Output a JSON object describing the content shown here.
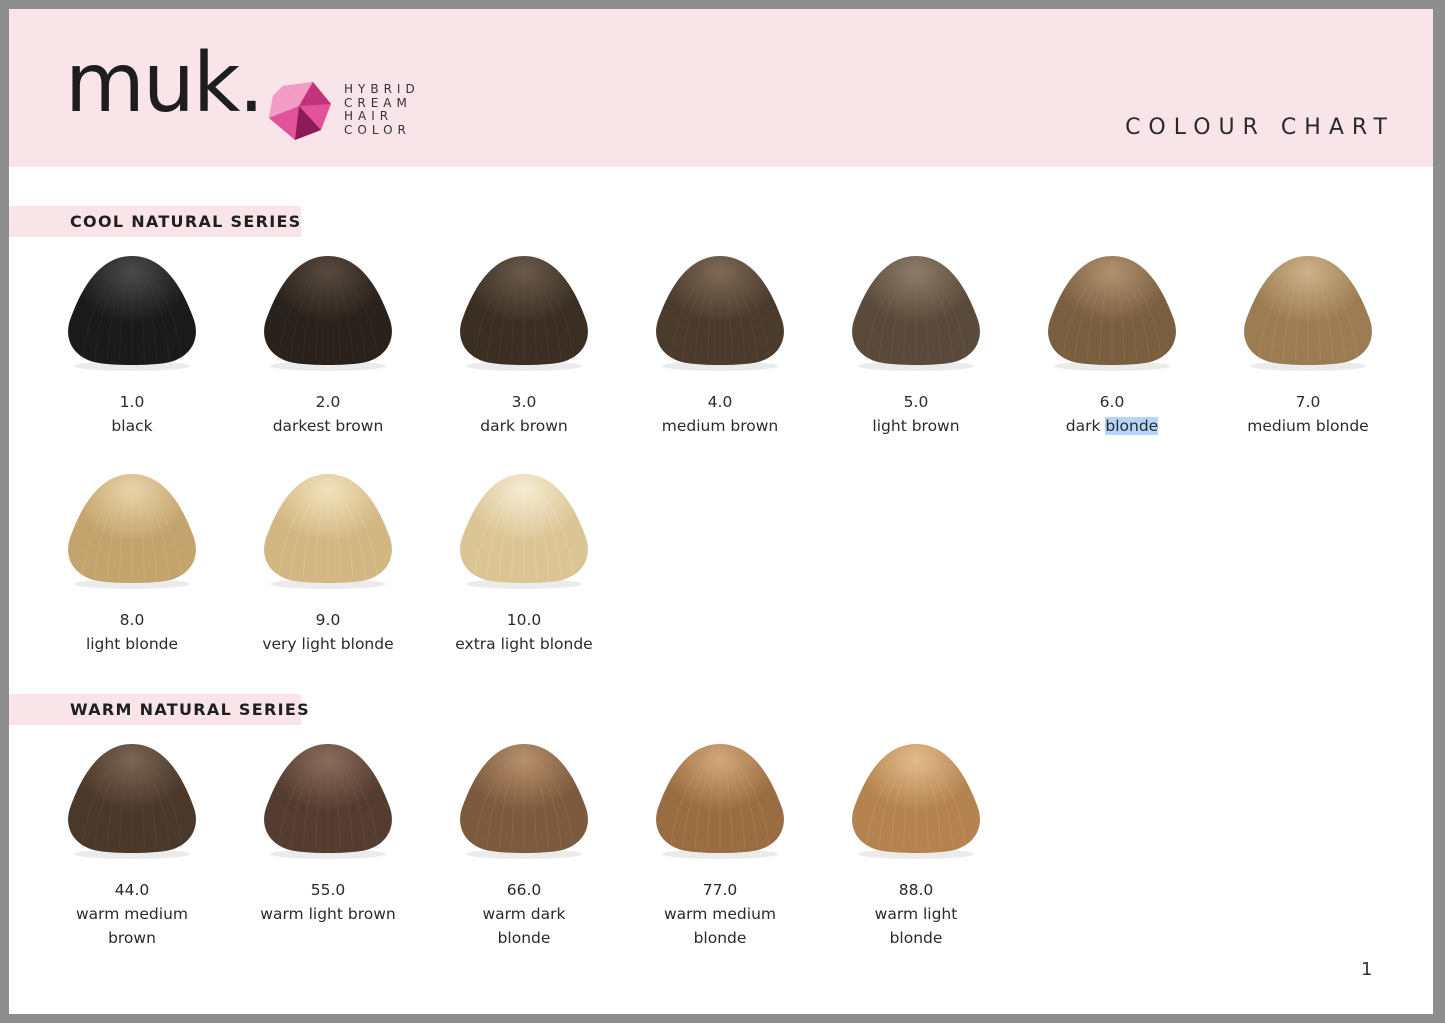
{
  "brand": {
    "logo": "muk.",
    "tagline": [
      "HYBRID",
      "CREAM",
      "HAIR",
      "COLOR"
    ],
    "gem_colors": [
      "#e3519a",
      "#c2337a",
      "#f29cc6",
      "#8c1c55"
    ]
  },
  "document": {
    "title": "COLOUR CHART",
    "page_number": "1"
  },
  "series": [
    {
      "title": "COOL NATURAL SERIES",
      "shades": [
        {
          "code": "1.0",
          "name": "black",
          "color": "#1a1a1a",
          "highlight": "#4a4a4a"
        },
        {
          "code": "2.0",
          "name": "darkest brown",
          "color": "#29211b",
          "highlight": "#574a40"
        },
        {
          "code": "3.0",
          "name": "dark brown",
          "color": "#3b2f24",
          "highlight": "#6a5a4a"
        },
        {
          "code": "4.0",
          "name": "medium brown",
          "color": "#4a3b2d",
          "highlight": "#7d6a55"
        },
        {
          "code": "5.0",
          "name": "light brown",
          "color": "#5a4a3b",
          "highlight": "#8e7c68"
        },
        {
          "code": "6.0",
          "name": "dark blonde",
          "color": "#7a5e40",
          "highlight": "#b09270",
          "selected_word": "blonde"
        },
        {
          "code": "7.0",
          "name": "medium blonde",
          "color": "#9c7c52",
          "highlight": "#cdb18a"
        },
        {
          "code": "8.0",
          "name": "light blonde",
          "color": "#c4a46d",
          "highlight": "#e8d3a8"
        },
        {
          "code": "9.0",
          "name": "very light blonde",
          "color": "#d3b783",
          "highlight": "#f1e2bd"
        },
        {
          "code": "10.0",
          "name": "extra light blonde",
          "color": "#dcc595",
          "highlight": "#f5ecd2"
        }
      ]
    },
    {
      "title": "WARM NATURAL SERIES",
      "shades": [
        {
          "code": "44.0",
          "name": "warm medium brown",
          "color": "#4a382b",
          "highlight": "#7a6452"
        },
        {
          "code": "55.0",
          "name": "warm light brown",
          "color": "#553c30",
          "highlight": "#8a6c5c"
        },
        {
          "code": "66.0",
          "name": "warm dark blonde",
          "color": "#7c5a3d",
          "highlight": "#b6906c"
        },
        {
          "code": "77.0",
          "name": "warm medium blonde",
          "color": "#9a6c42",
          "highlight": "#d3a77c"
        },
        {
          "code": "88.0",
          "name": "warm light blonde",
          "color": "#b4834f",
          "highlight": "#e2bb8a"
        }
      ]
    }
  ]
}
